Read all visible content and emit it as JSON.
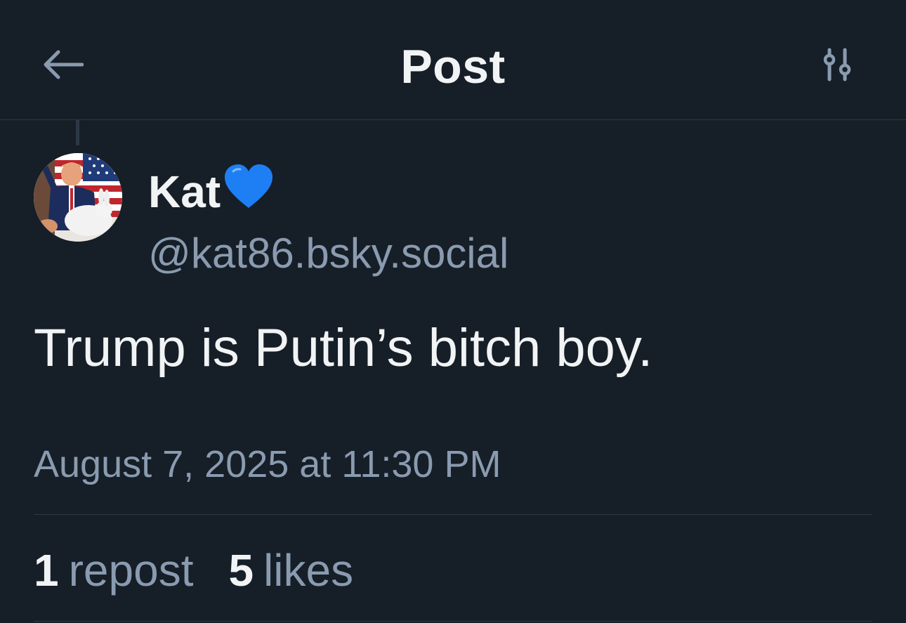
{
  "header": {
    "title": "Post",
    "back_icon": "arrow-left-icon",
    "settings_icon": "sliders-icon"
  },
  "post": {
    "author": {
      "display_name": "Kat",
      "badge_emoji": "💙",
      "handle": "@kat86.bsky.social"
    },
    "text": "Trump is Putin’s bitch boy.",
    "timestamp": "August 7, 2025 at 11:30 PM",
    "stats": {
      "reposts_count": "1",
      "reposts_label": "repost",
      "likes_count": "5",
      "likes_label": "likes"
    }
  },
  "colors": {
    "background": "#161e27",
    "text_primary": "#f1f3f5",
    "text_secondary": "#8a9bb0",
    "divider": "#2c3846",
    "heart": "#1e7ff5"
  }
}
